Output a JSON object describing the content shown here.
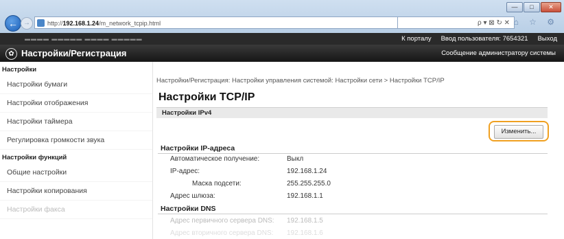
{
  "browser": {
    "url_prefix": "http://",
    "url_host": "192.168.1.24",
    "url_path": "/m_network_tcpip.html",
    "addr_tools": "ρ ▾ ⊠ ↻ ✕",
    "nav_icons": "⌂ ☆ ⚙",
    "win_min": "—",
    "win_max": "□",
    "win_close": "✕"
  },
  "header": {
    "portal_link": "К порталу",
    "user_label": "Ввод пользователя:",
    "user_id": "7654321",
    "logout": "Выход",
    "title": "Настройки/Регистрация",
    "admin_msg": "Сообщение администратору системы"
  },
  "sidebar": {
    "section1": "Настройки",
    "items1": [
      "Настройки бумаги",
      "Настройки отображения",
      "Настройки таймера",
      "Регулировка громкости звука"
    ],
    "section2": "Настройки функций",
    "items2": [
      "Общие настройки",
      "Настройки копирования",
      "Настройки факса"
    ]
  },
  "main": {
    "breadcrumb": "Настройки/Регистрация: Настройки управления системой: Настройки сети > Настройки TCP/IP",
    "title": "Настройки TCP/IP",
    "ipv4_bar": "Настройки IPv4",
    "edit_button": "Изменить...",
    "ip_section": "Настройки IP-адреса",
    "rows": [
      {
        "label": "Автоматическое получение:",
        "value": "Выкл"
      },
      {
        "label": "IP-адрес:",
        "value": "192.168.1.24"
      },
      {
        "label": "Маска подсети:",
        "value": "255.255.255.0"
      },
      {
        "label": "Адрес шлюза:",
        "value": "192.168.1.1"
      }
    ],
    "dns_section": "Настройки DNS",
    "dns_rows": [
      {
        "label": "Адрес первичного сервера DNS:",
        "value": "192.168.1.5"
      },
      {
        "label": "Адрес вторичного сервера DNS:",
        "value": "192.168.1.6"
      }
    ]
  }
}
